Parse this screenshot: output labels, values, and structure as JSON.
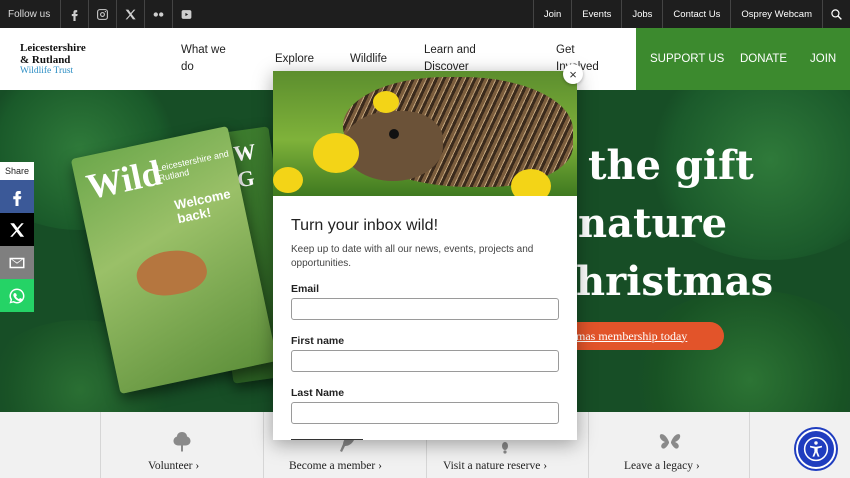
{
  "topbar": {
    "follow_label": "Follow us",
    "social": [
      "facebook-icon",
      "instagram-icon",
      "x-icon",
      "flickr-icon",
      "youtube-icon"
    ],
    "links": [
      "Join",
      "Events",
      "Jobs",
      "Contact Us",
      "Osprey Webcam"
    ]
  },
  "header": {
    "logo_line1": "Leicestershire",
    "logo_line2": "& Rutland",
    "logo_line3": "Wildlife Trust",
    "nav": {
      "n1": "What we do",
      "n2": "Explore",
      "n3": "Wildlife",
      "n4": "Learn and Discover",
      "n5": "Get Involved"
    },
    "cta": {
      "support": "SUPPORT US",
      "donate": "DONATE",
      "join": "JOIN"
    }
  },
  "hero": {
    "mag1_title": "Wild",
    "mag1_sub": "Leicestershire and Rutland",
    "mag1_back": "Welcome back!",
    "mag2_title": "W G",
    "line1": "the gift",
    "line2": "nature",
    "line3": "hristmas",
    "button": "mas membership today"
  },
  "share": {
    "label": "Share"
  },
  "modal": {
    "title": "Turn your inbox wild!",
    "description": "Keep up to date with all our news, events, projects and opportunities.",
    "email_label": "Email",
    "first_name_label": "First name",
    "last_name_label": "Last Name",
    "close": "×"
  },
  "tiles": {
    "t1": "Volunteer ›",
    "t2": "Become a member ›",
    "t3": "Visit a nature reserve ›",
    "t4": "Leave a legacy ›"
  },
  "colors": {
    "brand_green": "#3c8a2e",
    "hero_green": "#174e26",
    "orange": "#e2542a",
    "accessibility_blue": "#1f3dbf"
  }
}
